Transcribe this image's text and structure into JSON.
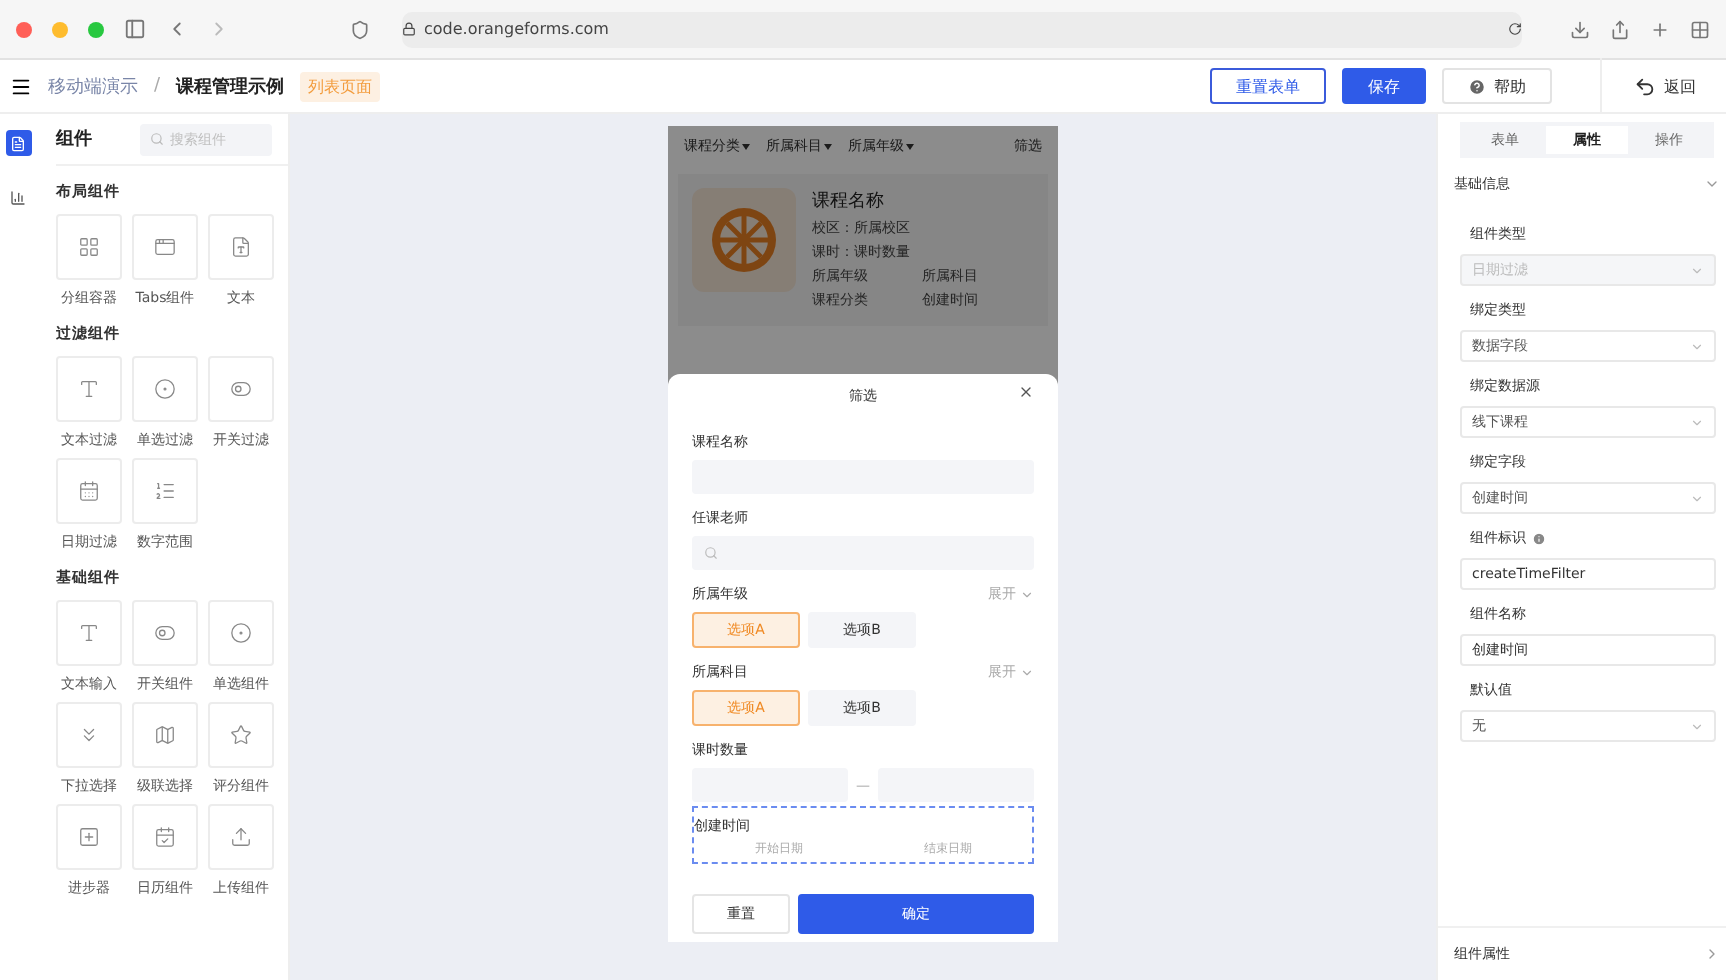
{
  "browser": {
    "url": "code.orangeforms.com"
  },
  "header": {
    "breadcrumb": [
      "移动端演示",
      "课程管理示例"
    ],
    "separator": "/",
    "tag": "列表页面",
    "buttons": [
      {
        "label": "重置表单",
        "kind": "outline"
      },
      {
        "label": "保存",
        "kind": "primary"
      },
      {
        "label": "帮助",
        "kind": "help"
      }
    ],
    "back": "返回"
  },
  "rail": [
    {
      "kind": "form",
      "selected": true
    },
    {
      "kind": "chart",
      "selected": false
    }
  ],
  "sidebar": {
    "title": "组件",
    "search": {
      "placeholder": "搜索组件"
    },
    "groups": [
      {
        "title": "布局组件",
        "items": [
          {
            "label": "分组容器",
            "kind": "grid"
          },
          {
            "label": "Tabs组件",
            "kind": "tabs"
          },
          {
            "label": "文本",
            "kind": "file"
          }
        ]
      },
      {
        "title": "过滤组件",
        "items": [
          {
            "label": "文本过滤",
            "kind": "text"
          },
          {
            "label": "单选过滤",
            "kind": "radio"
          },
          {
            "label": "开关过滤",
            "kind": "switch"
          },
          {
            "label": "日期过滤",
            "kind": "calendar"
          },
          {
            "label": "数字范围",
            "kind": "list"
          }
        ]
      },
      {
        "title": "基础组件",
        "items": [
          {
            "label": "文本输入",
            "kind": "text"
          },
          {
            "label": "开关组件",
            "kind": "switch"
          },
          {
            "label": "单选组件",
            "kind": "radio"
          },
          {
            "label": "下拉选择",
            "kind": "dropdown"
          },
          {
            "label": "级联选择",
            "kind": "map"
          },
          {
            "label": "评分组件",
            "kind": "star"
          },
          {
            "label": "进步器",
            "kind": "stepper"
          },
          {
            "label": "日历组件",
            "kind": "calendar-check"
          },
          {
            "label": "上传组件",
            "kind": "upload"
          }
        ]
      }
    ]
  },
  "phone": {
    "filters": [
      "课程分类",
      "所属科目",
      "所属年级"
    ],
    "filter_action": "筛选",
    "card": {
      "title": "课程名称",
      "lines": [
        "校区：所属校区",
        "课时：课时数量"
      ],
      "pairs": [
        [
          "所属年级",
          "所属科目"
        ],
        [
          "课程分类",
          "创建时间"
        ]
      ]
    },
    "sheet": {
      "title": "筛选",
      "sections": [
        {
          "kind": "text",
          "label": "课程名称"
        },
        {
          "kind": "search",
          "label": "任课老师"
        },
        {
          "kind": "chips",
          "label": "所属年级",
          "expand": "展开",
          "options": [
            {
              "label": "选项A",
              "selected": true
            },
            {
              "label": "选项B",
              "selected": false
            }
          ]
        },
        {
          "kind": "chips",
          "label": "所属科目",
          "expand": "展开",
          "options": [
            {
              "label": "选项A",
              "selected": true
            },
            {
              "label": "选项B",
              "selected": false
            }
          ]
        },
        {
          "kind": "range",
          "label": "课时数量",
          "separator": "—"
        },
        {
          "kind": "date",
          "label": "创建时间",
          "start": "开始日期",
          "end": "结束日期",
          "active": true
        }
      ],
      "buttons": [
        {
          "label": "重置",
          "kind": "plain"
        },
        {
          "label": "确定",
          "kind": "primary"
        }
      ]
    }
  },
  "panel": {
    "tabs": [
      {
        "label": "表单",
        "selected": false
      },
      {
        "label": "属性",
        "selected": true
      },
      {
        "label": "操作",
        "selected": false
      }
    ],
    "section": "基础信息",
    "fields": [
      {
        "label": "组件类型",
        "kind": "select",
        "value": "日期过滤",
        "disabled": true
      },
      {
        "label": "绑定类型",
        "kind": "select",
        "value": "数据字段",
        "disabled": false
      },
      {
        "label": "绑定数据源",
        "kind": "select",
        "value": "线下课程",
        "disabled": false
      },
      {
        "label": "绑定字段",
        "kind": "select",
        "value": "创建时间",
        "disabled": false
      },
      {
        "label": "组件标识",
        "kind": "input",
        "value": "createTimeFilter",
        "info": true
      },
      {
        "label": "组件名称",
        "kind": "input",
        "value": "创建时间"
      },
      {
        "label": "默认值",
        "kind": "select",
        "value": "无",
        "disabled": false
      }
    ],
    "footer": "组件属性"
  }
}
